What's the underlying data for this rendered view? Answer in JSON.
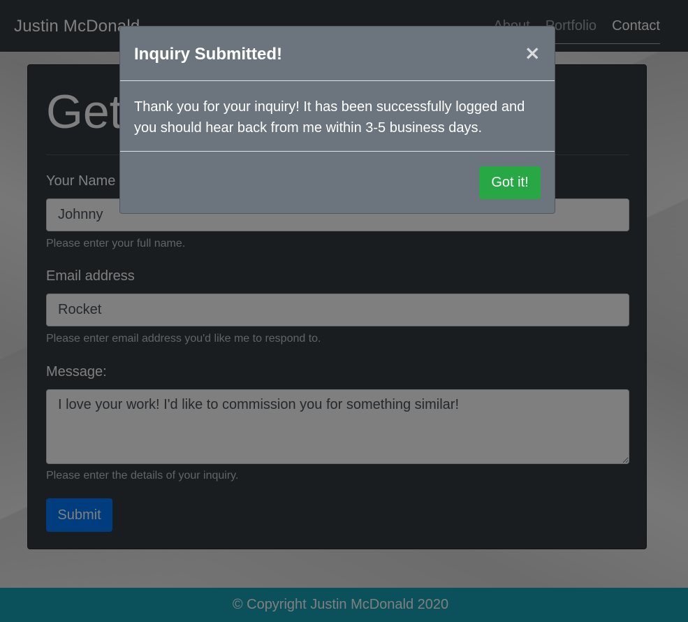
{
  "navbar": {
    "brand": "Justin McDonald",
    "links": [
      {
        "label": "About"
      },
      {
        "label": "Portfolio"
      },
      {
        "label": "Contact"
      }
    ]
  },
  "form": {
    "title": "Get",
    "name": {
      "label": "Your Name",
      "value": "Johnny",
      "help": "Please enter your full name."
    },
    "email": {
      "label": "Email address",
      "value": "Rocket",
      "help": "Please enter email address you'd like me to respond to."
    },
    "message": {
      "label": "Message:",
      "value": "I love your work! I'd like to commission you for something similar!",
      "help": "Please enter the details of your inquiry."
    },
    "submit_label": "Submit"
  },
  "footer": {
    "text": "© Copyright Justin McDonald 2020"
  },
  "modal": {
    "title": "Inquiry Submitted!",
    "close_glyph": "×",
    "body": "Thank you for your inquiry! It has been successfully logged and you should hear back from me within 3-5 business days.",
    "confirm_label": "Got it!"
  },
  "colors": {
    "navbar_bg": "#343a40",
    "card_bg": "#343a40",
    "modal_bg": "#6c757d",
    "primary": "#007bff",
    "success": "#28a745",
    "footer_bg": "#17a2b8"
  }
}
